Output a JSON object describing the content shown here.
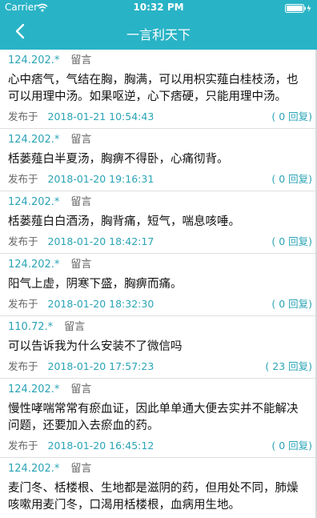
{
  "status_bar": {
    "carrier": "Carrier",
    "time": "10:32 PM"
  },
  "nav": {
    "title": "一言利天下"
  },
  "labels": {
    "tag": "留言",
    "published": "发布于"
  },
  "comments": [
    {
      "ip": "124.202.*",
      "text": "心中痞气，气结在胸，胸满，可以用枳实薤白桂枝汤，也可以用理中汤。如果呕逆，心下痞硬，只能用理中汤。",
      "date": "2018-01-21 10:54:43",
      "replies": "( 0 回复)"
    },
    {
      "ip": "124.202.*",
      "text": "栝蒌薤白半夏汤，胸痹不得卧，心痛彻背。",
      "date": "2018-01-20 19:16:31",
      "replies": "( 0 回复)"
    },
    {
      "ip": "124.202.*",
      "text": "栝蒌薤白白酒汤，胸背痛，短气，喘息咳唾。",
      "date": "2018-01-20 18:42:17",
      "replies": "( 0 回复)"
    },
    {
      "ip": "124.202.*",
      "text": "阳气上虚，阴寒下盛，胸痹而痛。",
      "date": "2018-01-20 18:32:30",
      "replies": "( 0 回复)"
    },
    {
      "ip": "110.72.*",
      "text": "可以告诉我为什么安装不了微信吗",
      "date": "2018-01-20 17:57:23",
      "replies": "( 23 回复)"
    },
    {
      "ip": "124.202.*",
      "text": "慢性哮喘常常有瘀血证，因此单单通大便去实并不能解决问题，还要加入去瘀血的药。",
      "date": "2018-01-20 16:45:12",
      "replies": "( 0 回复)"
    },
    {
      "ip": "124.202.*",
      "text": "麦门冬、栝楼根、生地都是滋阴的药，但用处不同，肺燥咳嗽用麦门冬，口渴用栝楼根，血病用生地。",
      "date": "",
      "replies": ""
    }
  ]
}
